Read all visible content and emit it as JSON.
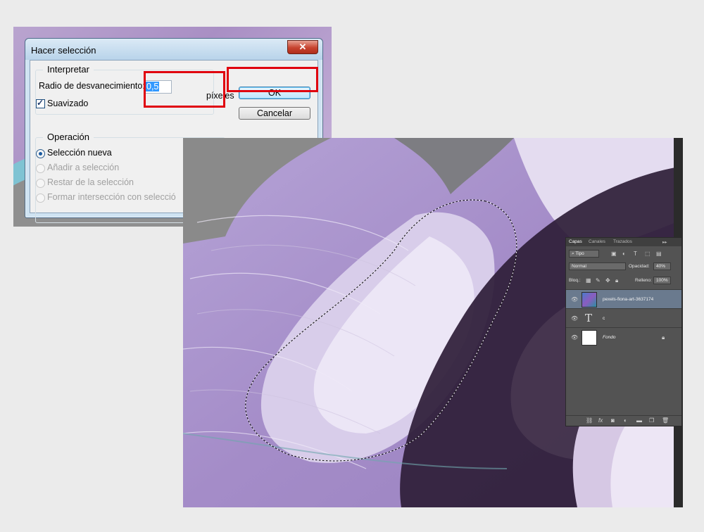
{
  "dialog": {
    "title": "Hacer selección",
    "close_label": "✕",
    "interpret": {
      "group_label": "Interpretar",
      "feather_label": "Radio de desvanecimiento:",
      "feather_value": "0,5",
      "feather_unit": "píxeles",
      "antialias_label": "Suavizado",
      "antialias_checked": true
    },
    "operation": {
      "group_label": "Operación",
      "options": [
        "Selección nueva",
        "Añadir a selección",
        "Restar de la selección",
        "Formar intersección con selecció"
      ],
      "selected_index": 0
    },
    "ok_label": "OK",
    "cancel_label": "Cancelar"
  },
  "highlight_color": "#e0000e",
  "layers_panel": {
    "tabs": [
      "Capas",
      "Canales",
      "Trazados"
    ],
    "active_tab": "Capas",
    "menu_glyph": "▸▸",
    "filter_label": "Tipo",
    "blend_mode": "Normal",
    "opacity_label": "Opacidad:",
    "opacity_value": "40%",
    "lock_label": "Bloq.:",
    "fill_label": "Relleno:",
    "fill_value": "100%",
    "layers": [
      {
        "name": "pexels-fiona-art-3637174",
        "type": "image",
        "selected": true
      },
      {
        "name": "c",
        "type": "text",
        "selected": false
      },
      {
        "name": "Fondo",
        "type": "background",
        "selected": false,
        "locked": true
      }
    ]
  }
}
